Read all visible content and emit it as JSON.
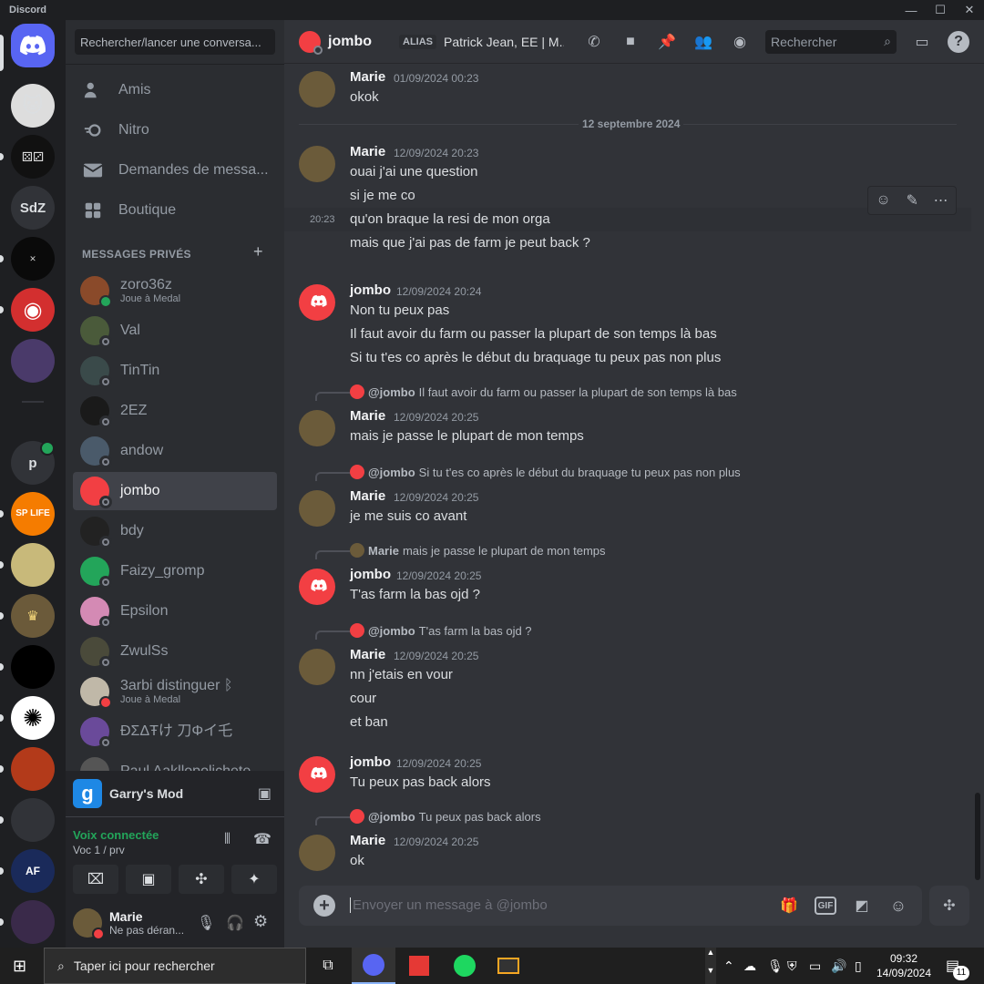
{
  "app": {
    "title": "Discord"
  },
  "servers": [
    {
      "label": ""
    },
    {
      "label": ""
    },
    {
      "label": ""
    },
    {
      "label": "SdZ"
    },
    {
      "label": ""
    },
    {
      "label": ""
    },
    {
      "label": ""
    },
    {
      "label": "p"
    },
    {
      "label": "SP LIFE"
    },
    {
      "label": ""
    },
    {
      "label": ""
    },
    {
      "label": ""
    },
    {
      "label": ""
    },
    {
      "label": ""
    },
    {
      "label": ""
    },
    {
      "label": ""
    },
    {
      "label": ""
    }
  ],
  "sidebar": {
    "search_placeholder": "Rechercher/lancer une conversa...",
    "nav": [
      {
        "label": "Amis",
        "icon": "friends-icon"
      },
      {
        "label": "Nitro",
        "icon": "nitro-icon"
      },
      {
        "label": "Demandes de messa...",
        "icon": "envelope-icon"
      },
      {
        "label": "Boutique",
        "icon": "shop-icon"
      }
    ],
    "dm_header": "MESSAGES PRIVÉS",
    "dms": [
      {
        "name": "zoro36z",
        "sub": "Joue à Medal",
        "status": "online",
        "color": "#8a4a2a"
      },
      {
        "name": "Val",
        "sub": "",
        "status": "offline",
        "color": "#4a5a3a"
      },
      {
        "name": "TinTin",
        "sub": "",
        "status": "offline",
        "color": "#3a4a4a"
      },
      {
        "name": "2EZ",
        "sub": "",
        "status": "offline",
        "color": "#1a1a1a"
      },
      {
        "name": "andow",
        "sub": "",
        "status": "offline",
        "color": "#4a5a6a"
      },
      {
        "name": "jombo",
        "sub": "",
        "status": "offline",
        "color": "#f23f43"
      },
      {
        "name": "bdy",
        "sub": "",
        "status": "offline",
        "color": "#222"
      },
      {
        "name": "Faizy_gromp",
        "sub": "",
        "status": "offline",
        "color": "#23a55a"
      },
      {
        "name": "Epsilon",
        "sub": "",
        "status": "offline",
        "color": "#d48ab4"
      },
      {
        "name": "ZwulSs",
        "sub": "",
        "status": "offline",
        "color": "#4a4a3a"
      },
      {
        "name": "3arbi distinguer ᛒ",
        "sub": "Joue à Medal",
        "status": "dnd",
        "color": "#c0b8a8"
      },
      {
        "name": "ÐΣΔŦけ 刀Φイ乇",
        "sub": "",
        "status": "offline",
        "color": "#6a4a9a"
      },
      {
        "name": "Paul Aakllopolichete",
        "sub": "",
        "status": "offline",
        "color": "#555"
      }
    ],
    "game": "Garry's Mod",
    "voice": {
      "status": "Voix connectée",
      "channel": "Voc 1 / prv"
    },
    "user": {
      "name": "Marie",
      "status": "Ne pas déran..."
    }
  },
  "header": {
    "name": "jombo",
    "alias_label": "ALIAS",
    "alias_value": "Patrick Jean, EE | M...",
    "search_placeholder": "Rechercher"
  },
  "chat": {
    "date_divider": "12 septembre 2024",
    "hover_time": "20:23",
    "messages": [
      {
        "author": "Marie",
        "time": "01/09/2024 00:23",
        "lines": [
          "okok"
        ]
      },
      {
        "author": "Marie",
        "time": "12/09/2024 20:23",
        "lines": [
          "ouai j'ai une question",
          "si je me co",
          "qu'on braque la resi de mon orga",
          "mais que j'ai pas de farm je peut back ?"
        ]
      },
      {
        "author": "jombo",
        "time": "12/09/2024 20:24",
        "lines": [
          "Non tu peux pas",
          "Il faut avoir du farm ou passer la plupart de son temps là bas",
          "Si tu t'es co après le début du braquage tu peux pas non plus"
        ]
      },
      {
        "author": "Marie",
        "time": "12/09/2024 20:25",
        "reply_author": "@jombo",
        "reply_text": "Il faut avoir du farm ou passer la plupart de son temps là bas",
        "lines": [
          "mais je passe le plupart de mon temps"
        ]
      },
      {
        "author": "Marie",
        "time": "12/09/2024 20:25",
        "reply_author": "@jombo",
        "reply_text": "Si tu t'es co après le début du braquage tu peux pas non plus",
        "lines": [
          "je me suis co avant"
        ]
      },
      {
        "author": "jombo",
        "time": "12/09/2024 20:25",
        "reply_author": "Marie",
        "reply_text": "mais je passe le plupart de mon temps",
        "lines": [
          "T'as farm la bas ojd ?"
        ]
      },
      {
        "author": "Marie",
        "time": "12/09/2024 20:25",
        "reply_author": "@jombo",
        "reply_text": "T'as farm la bas ojd ?",
        "lines": [
          "nn j'etais en vour",
          "cour",
          "et ban"
        ]
      },
      {
        "author": "jombo",
        "time": "12/09/2024 20:25",
        "lines": [
          "Tu peux pas back alors"
        ]
      },
      {
        "author": "Marie",
        "time": "12/09/2024 20:25",
        "reply_author": "@jombo",
        "reply_text": "Tu peux pas back alors",
        "lines": [
          "ok"
        ]
      }
    ]
  },
  "composer": {
    "placeholder": "Envoyer un message à @jombo",
    "gif_label": "GIF"
  },
  "taskbar": {
    "search_placeholder": "Taper ici pour rechercher",
    "time": "09:32",
    "date": "14/09/2024",
    "notif_count": "11"
  },
  "colors": {
    "accent": "#5865f2",
    "jombo": "#f23f43",
    "online": "#23a55a"
  }
}
